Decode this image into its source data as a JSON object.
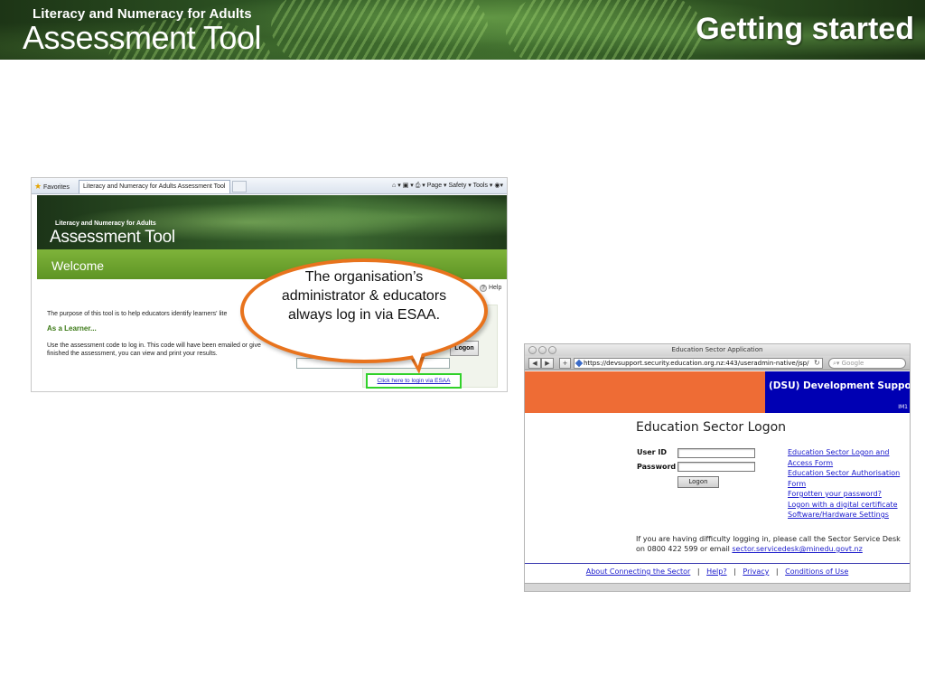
{
  "banner": {
    "subtitle": "Literacy and Numeracy for Adults",
    "title": "Assessment Tool",
    "slide_title": "Getting started"
  },
  "assessment_screenshot": {
    "browser": {
      "favorites_label": "Favorites",
      "tab_title": "Literacy and Numeracy for Adults Assessment Tool",
      "commands": "Page ▾   Safety ▾   Tools ▾"
    },
    "header_small": "Literacy and Numeracy for Adults",
    "header_big": "Assessment Tool",
    "welcome": "Welcome",
    "help_label": "Help",
    "purpose_text": "The purpose of this tool is to help educators identify learners' lite",
    "learner_heading": "As a Learner...",
    "use_text": "Use the assessment code to log in. This code will have been emailed or give finished the assessment, you can view and print your results.",
    "logon_button": "Logon",
    "esaa_link": "Click here to login via ESAA"
  },
  "callout": {
    "text": "The organisation’s administrator & educators always log in via ESAA.",
    "border_color": "#e8731d"
  },
  "logon_screenshot": {
    "window_title": "Education Sector Application",
    "url": "https://devsupport.security.education.org.nz:443/useradmin-native/jsp/",
    "search_placeholder": "Google",
    "dsu_banner": "(DSU) Development Support",
    "im_label": "IM1",
    "heading": "Education Sector Logon",
    "user_id_label": "User ID",
    "password_label": "Password",
    "logon_button": "Logon",
    "links": [
      "Education Sector Logon and Access Form",
      "Education Sector Authorisation Form",
      "Forgotten your password?",
      "Logon with a digital certificate",
      "Software/Hardware Settings"
    ],
    "help_text": "If you are having difficulty logging in, please call the Sector Service Desk on 0800 422 599 or email",
    "help_email": "sector.servicedesk@minedu.govt.nz",
    "footer": {
      "about": "About Connecting the Sector",
      "help": "Help?",
      "privacy": "Privacy",
      "conditions": "Conditions of Use",
      "separator": "|"
    },
    "colors": {
      "orange": "#ee6c35",
      "blue": "#0000b3",
      "link": "#1a1acc"
    }
  }
}
